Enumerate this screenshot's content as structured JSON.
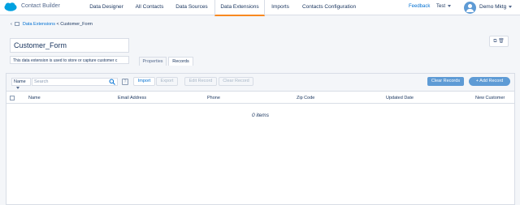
{
  "app": {
    "name": "Contact Builder"
  },
  "nav": {
    "tabs": [
      "Data Designer",
      "All Contacts",
      "Data Sources",
      "Data Extensions",
      "Imports",
      "Contacts Configuration"
    ],
    "active_tab": "Data Extensions",
    "feedback": "Feedback",
    "business_unit": "Test",
    "user": "Demo Mktg"
  },
  "breadcrumb": {
    "parent": "Data Extensions",
    "separator": "<",
    "current": "Customer_Form"
  },
  "data_extension": {
    "name": "Customer_Form",
    "description": "This data extension is used to store or capture customer c"
  },
  "tabs": {
    "properties": "Properties",
    "records": "Records",
    "active": "Records"
  },
  "toolbar": {
    "filter_select": "Name",
    "search_placeholder": "Search",
    "help": "?",
    "import": "Import",
    "export": "Export",
    "edit_record": "Edit Record",
    "clear_record": "Clear Record",
    "clear_records": "Clear Records",
    "add_record": "+ Add Record"
  },
  "table": {
    "columns": [
      "Name",
      "Email Address",
      "Phone",
      "Zip Code",
      "Updated Date",
      "New Customer"
    ],
    "rows": [],
    "empty_text": "0 items"
  },
  "colors": {
    "brand": "#0070d2",
    "accent": "#f88920",
    "button": "#5e9bd5",
    "logo": "#00a1e0"
  }
}
